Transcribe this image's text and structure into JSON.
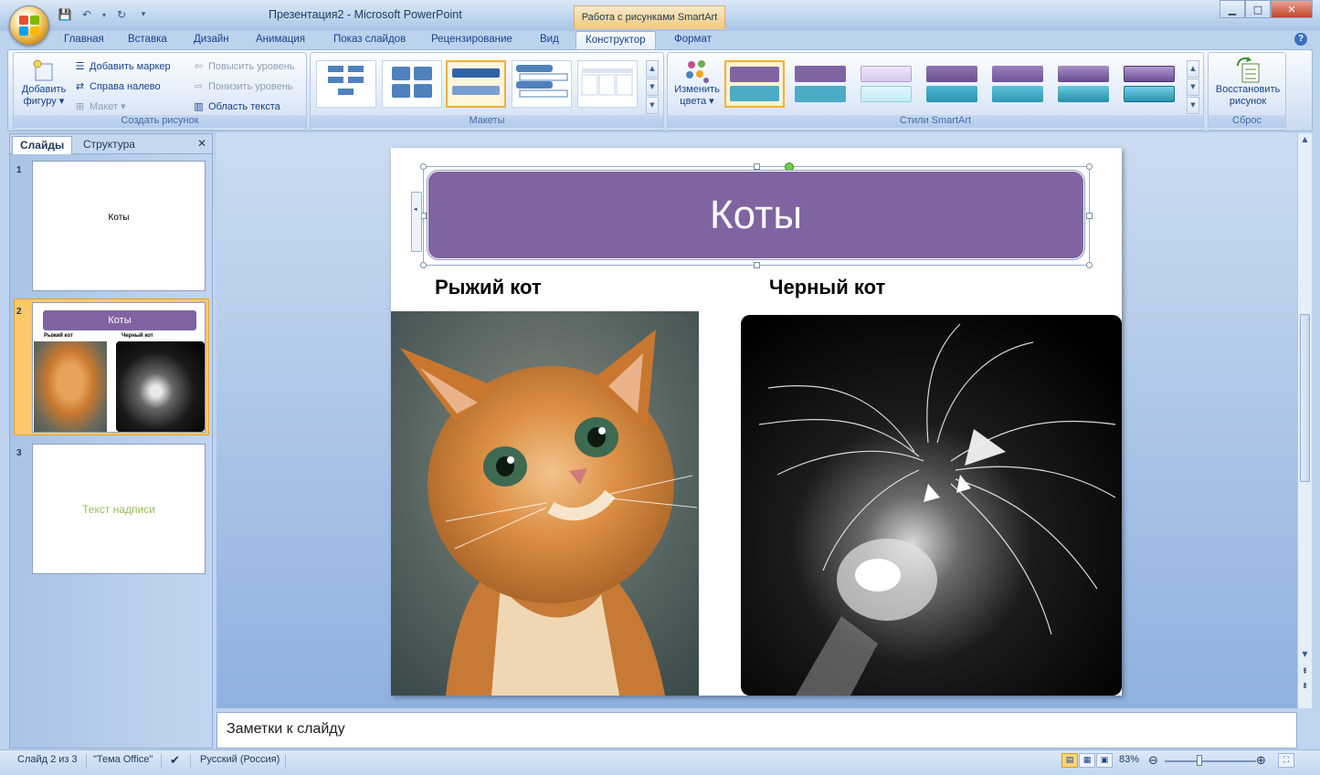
{
  "window": {
    "title": "Презентация2 - Microsoft PowerPoint",
    "context_tab_title": "Работа с рисунками SmartArt"
  },
  "qat": {
    "save_icon": "save-icon",
    "undo_icon": "undo-icon",
    "redo_icon": "redo-icon"
  },
  "ribbon_tabs": [
    {
      "label": "Главная"
    },
    {
      "label": "Вставка"
    },
    {
      "label": "Дизайн"
    },
    {
      "label": "Анимация"
    },
    {
      "label": "Показ слайдов"
    },
    {
      "label": "Рецензирование"
    },
    {
      "label": "Вид"
    },
    {
      "label": "Конструктор",
      "active": true
    },
    {
      "label": "Формат"
    }
  ],
  "groups": {
    "create": {
      "label": "Создать рисунок",
      "add_shape": "Добавить фигуру ▾",
      "add_shape_line1": "Добавить",
      "add_shape_line2": "фигуру ▾",
      "add_bullet": "Добавить маркер",
      "right_to_left": "Справа налево",
      "layout": "Макет ▾",
      "promote": "Повысить уровень",
      "demote": "Понизить уровень",
      "text_pane": "Область текста"
    },
    "layouts": {
      "label": "Макеты",
      "selected_index": 2
    },
    "styles": {
      "label": "Стили SmartArt",
      "change_colors_line1": "Изменить",
      "change_colors_line2": "цвета ▾",
      "selected_index": 0
    },
    "reset": {
      "label": "Сброс",
      "reset_graphic_line1": "Восстановить",
      "reset_graphic_line2": "рисунок"
    }
  },
  "left_pane": {
    "tab_slides": "Слайды",
    "tab_outline": "Структура",
    "slides": [
      {
        "number": "1",
        "title": "Коты"
      },
      {
        "number": "2",
        "title": "Коты",
        "caption_left": "Рыжий кот",
        "caption_right": "Черный кот",
        "selected": true
      },
      {
        "number": "3",
        "text": "Текст надписи"
      }
    ]
  },
  "slide": {
    "title": "Коты",
    "caption_left": "Рыжий кот",
    "caption_right": "Черный кот"
  },
  "notes": {
    "placeholder": "Заметки к слайду"
  },
  "status": {
    "slide_of": "Слайд 2 из 3",
    "theme": "\"Тема Office\"",
    "language": "Русский (Россия)",
    "zoom": "83%"
  },
  "colors": {
    "smartart_purple": "#8064a2",
    "accent_orange": "#f0b03c",
    "text_placeholder_green": "#9bbb59"
  }
}
